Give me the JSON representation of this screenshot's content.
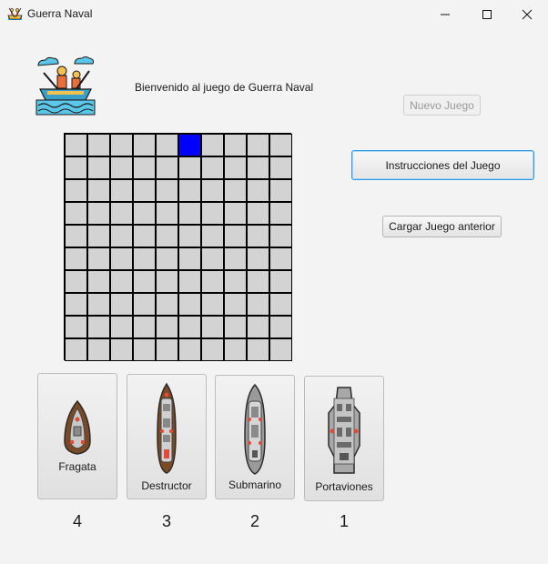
{
  "window": {
    "title": "Guerra Naval",
    "icon": "boat-rowers-icon",
    "controls": [
      "minimize-icon",
      "maximize-icon",
      "close-icon"
    ]
  },
  "header": {
    "logo_icon": "boat-rowers-icon",
    "welcome": "Bienvenido al juego de Guerra Naval"
  },
  "actions": {
    "new_game": "Nuevo Juego",
    "instructions": "Instrucciones del Juego",
    "load_game": "Cargar Juego anterior"
  },
  "board": {
    "rows": 10,
    "cols": 10,
    "selected_cell": {
      "row": 1,
      "col": 6
    },
    "cell_color": "#d3d3d3",
    "selected_color": "#0000ff"
  },
  "ships": [
    {
      "name": "Fragata",
      "count": "4",
      "icon": "frigate-icon"
    },
    {
      "name": "Destructor",
      "count": "3",
      "icon": "destroyer-icon"
    },
    {
      "name": "Submarino",
      "count": "2",
      "icon": "submarine-icon"
    },
    {
      "name": "Portaviones",
      "count": "1",
      "icon": "aircraft-carrier-icon"
    }
  ]
}
